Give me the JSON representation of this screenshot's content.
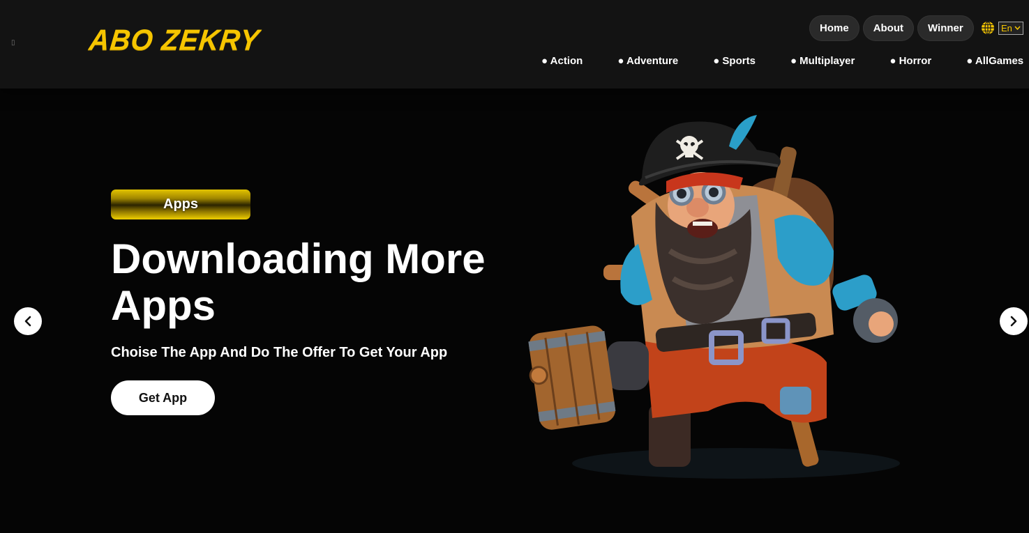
{
  "header": {
    "logo_text": "ABO ZEKRY",
    "tiny_glyph": "▯",
    "top_nav": [
      {
        "label": "Home"
      },
      {
        "label": "About"
      },
      {
        "label": "Winner"
      }
    ],
    "language": {
      "selected": "En",
      "icon": "globe-icon"
    },
    "categories": [
      {
        "label": "● Action"
      },
      {
        "label": "● Adventure"
      },
      {
        "label": "● Sports"
      },
      {
        "label": "● Multiplayer"
      },
      {
        "label": "● Horror"
      },
      {
        "label": "● AllGames"
      }
    ]
  },
  "hero": {
    "badge": "Apps",
    "title": "Downloading More Apps",
    "subtitle": "Choise The App And Do The Offer To Get Your App",
    "cta": "Get App",
    "prev_icon": "chevron-left-icon",
    "next_icon": "chevron-right-icon",
    "art": "pirate-character-illustration"
  },
  "colors": {
    "brand_yellow": "#f6c500",
    "header_bg": "#131313",
    "page_bg": "#050505",
    "pill_bg": "#2a2a2a"
  }
}
